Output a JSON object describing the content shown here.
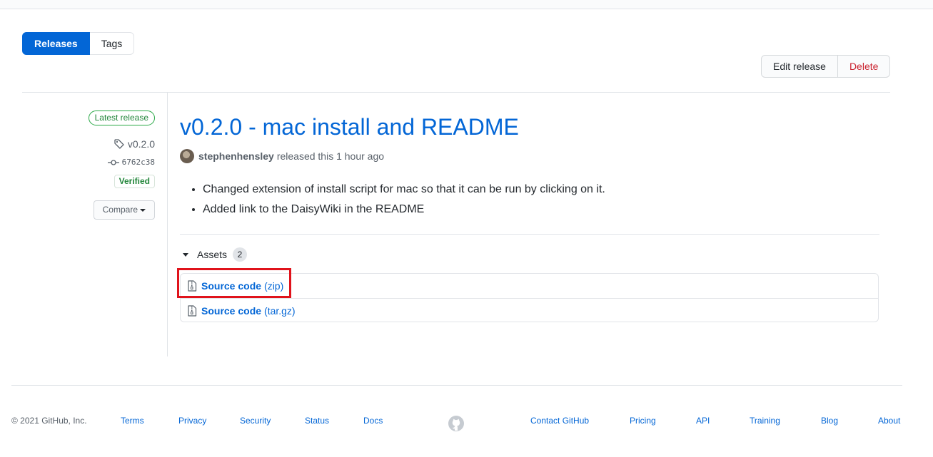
{
  "subnav": {
    "releases_label": "Releases",
    "tags_label": "Tags"
  },
  "actions": {
    "edit_label": "Edit release",
    "delete_label": "Delete"
  },
  "meta": {
    "latest_badge": "Latest release",
    "tag": "v0.2.0",
    "commit": "6762c38",
    "verified": "Verified",
    "compare_label": "Compare"
  },
  "release": {
    "title": "v0.2.0 - mac install and README",
    "author": "stephenhensley",
    "released_text": "released this 1 hour ago",
    "notes": [
      "Changed extension of install script for mac so that it can be run by clicking on it.",
      "Added link to the DaisyWiki in the README"
    ]
  },
  "assets": {
    "heading": "Assets",
    "count": "2",
    "items": [
      {
        "name": "Source code",
        "ext": "(zip)"
      },
      {
        "name": "Source code",
        "ext": "(tar.gz)"
      }
    ]
  },
  "footer": {
    "copyright": "© 2021 GitHub, Inc.",
    "links_left": [
      "Terms",
      "Privacy",
      "Security",
      "Status",
      "Docs"
    ],
    "links_right": [
      "Contact GitHub",
      "Pricing",
      "API",
      "Training",
      "Blog",
      "About"
    ]
  },
  "colors": {
    "accent": "#0366d6",
    "danger": "#cb2431",
    "success": "#28a745",
    "highlight": "#e0131b"
  }
}
